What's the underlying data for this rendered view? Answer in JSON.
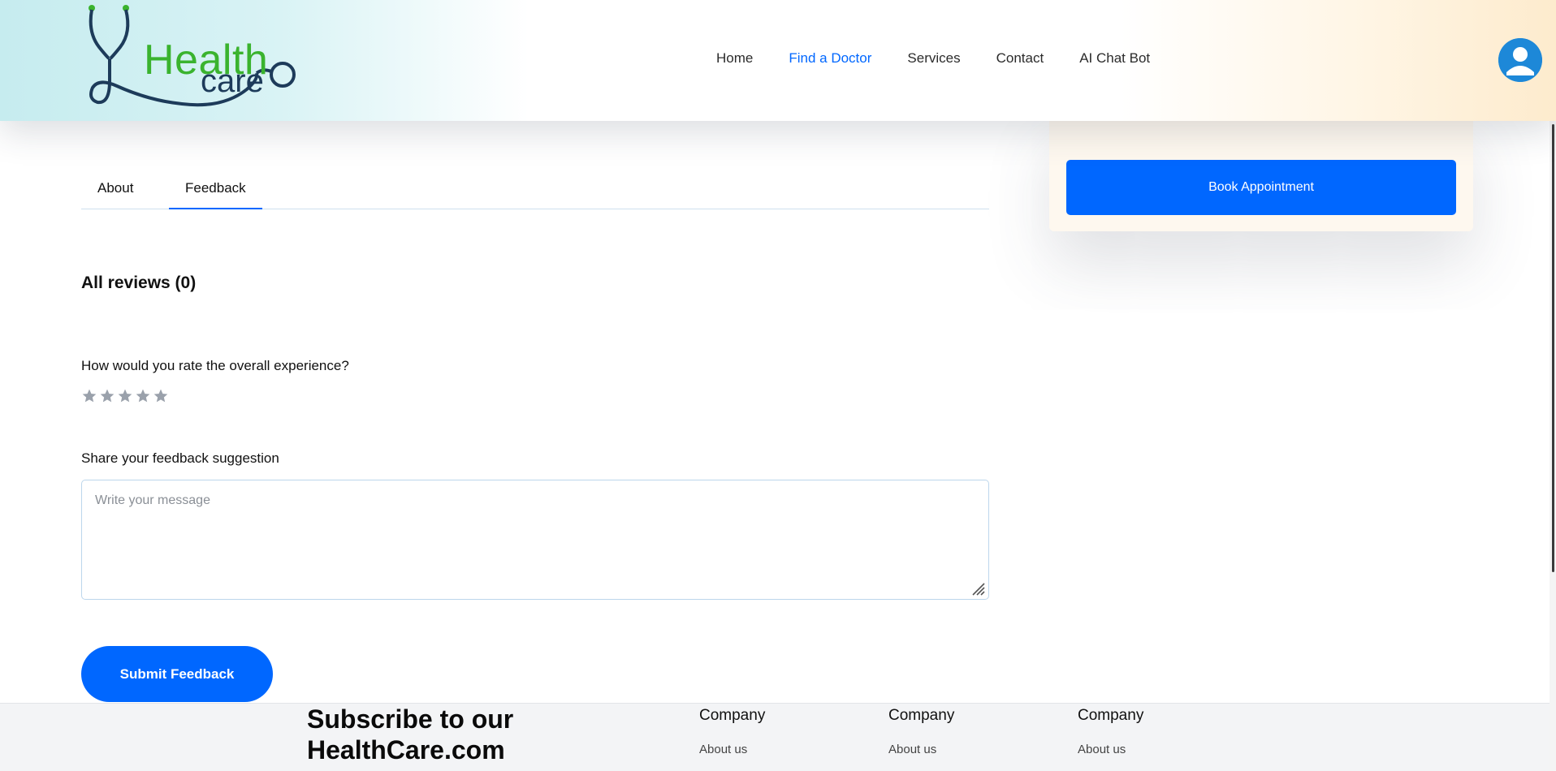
{
  "header": {
    "logo": {
      "word1": "Health",
      "word2": "care",
      "icon": "stethoscope-icon"
    },
    "nav": [
      {
        "label": "Home",
        "active": false
      },
      {
        "label": "Find a Doctor",
        "active": true
      },
      {
        "label": "Services",
        "active": false
      },
      {
        "label": "Contact",
        "active": false
      },
      {
        "label": "AI Chat Bot",
        "active": false
      }
    ],
    "avatar_icon": "user-avatar-icon"
  },
  "side_card": {
    "book_label": "Book Appointment"
  },
  "tabs": [
    {
      "label": "About",
      "active": false
    },
    {
      "label": "Feedback",
      "active": true
    }
  ],
  "reviews": {
    "title": "All reviews (0)"
  },
  "feedback_form": {
    "rate_label": "How would you rate the overall experience?",
    "stars_count": 5,
    "rating": 0,
    "share_label": "Share your feedback suggestion",
    "message_placeholder": "Write your message",
    "message_value": "",
    "submit_label": "Submit Feedback"
  },
  "footer": {
    "subscribe_line1": "Subscribe to our",
    "subscribe_line2": "HealthCare.com",
    "columns": [
      {
        "title": "Company",
        "links": [
          "About us"
        ]
      },
      {
        "title": "Company",
        "links": [
          "About us"
        ]
      },
      {
        "title": "Company",
        "links": [
          "About us"
        ]
      }
    ]
  },
  "colors": {
    "accent": "#0067ff",
    "logo_green": "#3ab32e",
    "logo_navy": "#1d3b5a",
    "star_empty": "#9aa1ab",
    "footer_bg": "#f3f4f6"
  }
}
